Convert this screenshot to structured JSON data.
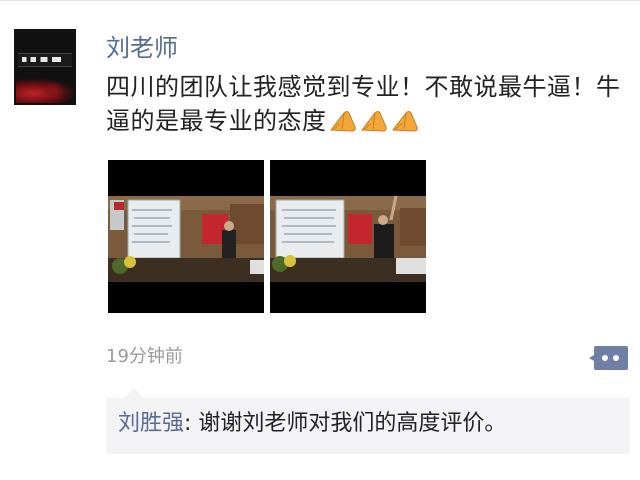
{
  "post": {
    "author": "刘老师",
    "text": "四川的团队让我感觉到专业！不敢说最牛逼！牛逼的是最专业的态度",
    "emoji_icons": [
      "hands-icon",
      "hands-icon",
      "hands-icon"
    ],
    "photos_count": 2,
    "time": "19分钟前"
  },
  "comments": [
    {
      "name": "刘胜强",
      "separator": ": ",
      "text": "谢谢刘老师对我们的高度评价。"
    }
  ],
  "colors": {
    "link": "#576b95",
    "text": "#222222",
    "muted": "#9a9a9a",
    "comment_bg": "#f3f3f5",
    "emoji": "#f2a73b"
  }
}
